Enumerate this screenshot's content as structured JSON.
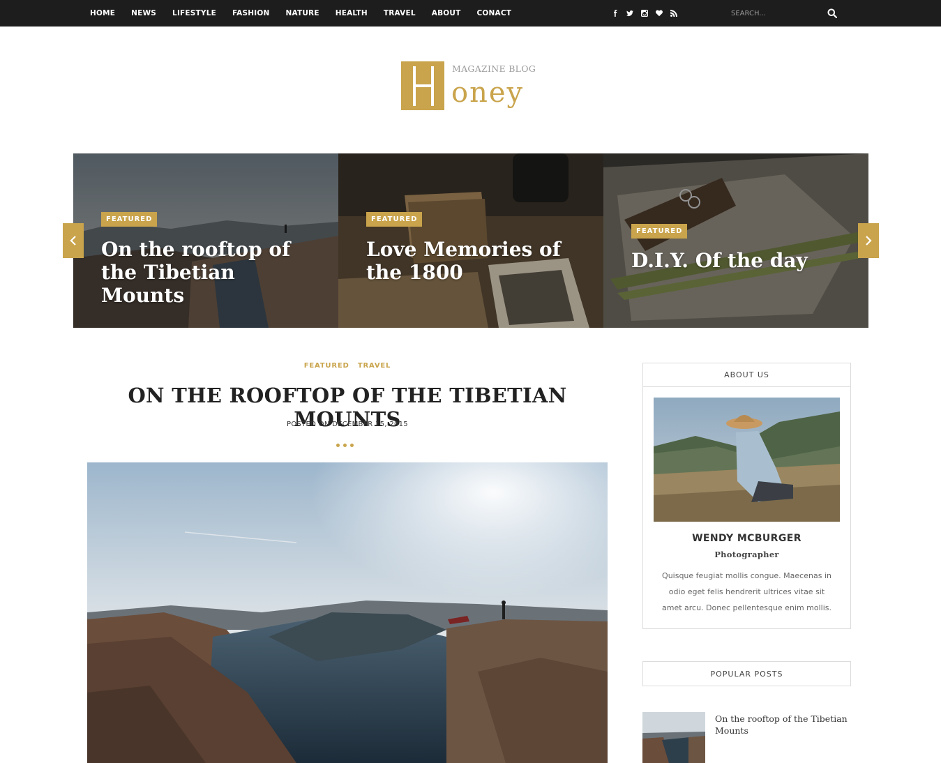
{
  "nav": {
    "items": [
      "HOME",
      "NEWS",
      "LIFESTYLE",
      "FASHION",
      "NATURE",
      "HEALTH",
      "TRAVEL",
      "ABOUT",
      "CONACT"
    ],
    "social": [
      "facebook-icon",
      "twitter-icon",
      "instagram-icon",
      "heart-icon",
      "rss-icon"
    ],
    "search_placeholder": "SEARCH..."
  },
  "logo": {
    "tagline": "MAGAZINE BLOG",
    "word": "oney"
  },
  "slider": {
    "slides": [
      {
        "tag": "FEATURED",
        "title": "On the rooftop of the Tibetian Mounts"
      },
      {
        "tag": "FEATURED",
        "title": "Love Memories of the 1800"
      },
      {
        "tag": "FEATURED",
        "title": "D.I.Y. Of the day"
      }
    ]
  },
  "post": {
    "categories": [
      "FEATURED",
      "TRAVEL"
    ],
    "title": "ON THE ROOFTOP OF THE TIBETIAN MOUNTS",
    "date": "POSTED ON DECEMBER 15, 2015"
  },
  "about": {
    "heading": "ABOUT US",
    "name": "WENDY MCBURGER",
    "role": "Photographer",
    "bio": "Quisque feugiat mollis congue. Maecenas in odio eget felis hendrerit ultrices vitae sit amet arcu. Donec pellentesque enim mollis."
  },
  "popular": {
    "heading": "POPULAR POSTS",
    "items": [
      {
        "title": "On the rooftop of the Tibetian Mounts"
      }
    ]
  },
  "colors": {
    "accent": "#c9a44c",
    "topbar": "#1d1d1d"
  }
}
